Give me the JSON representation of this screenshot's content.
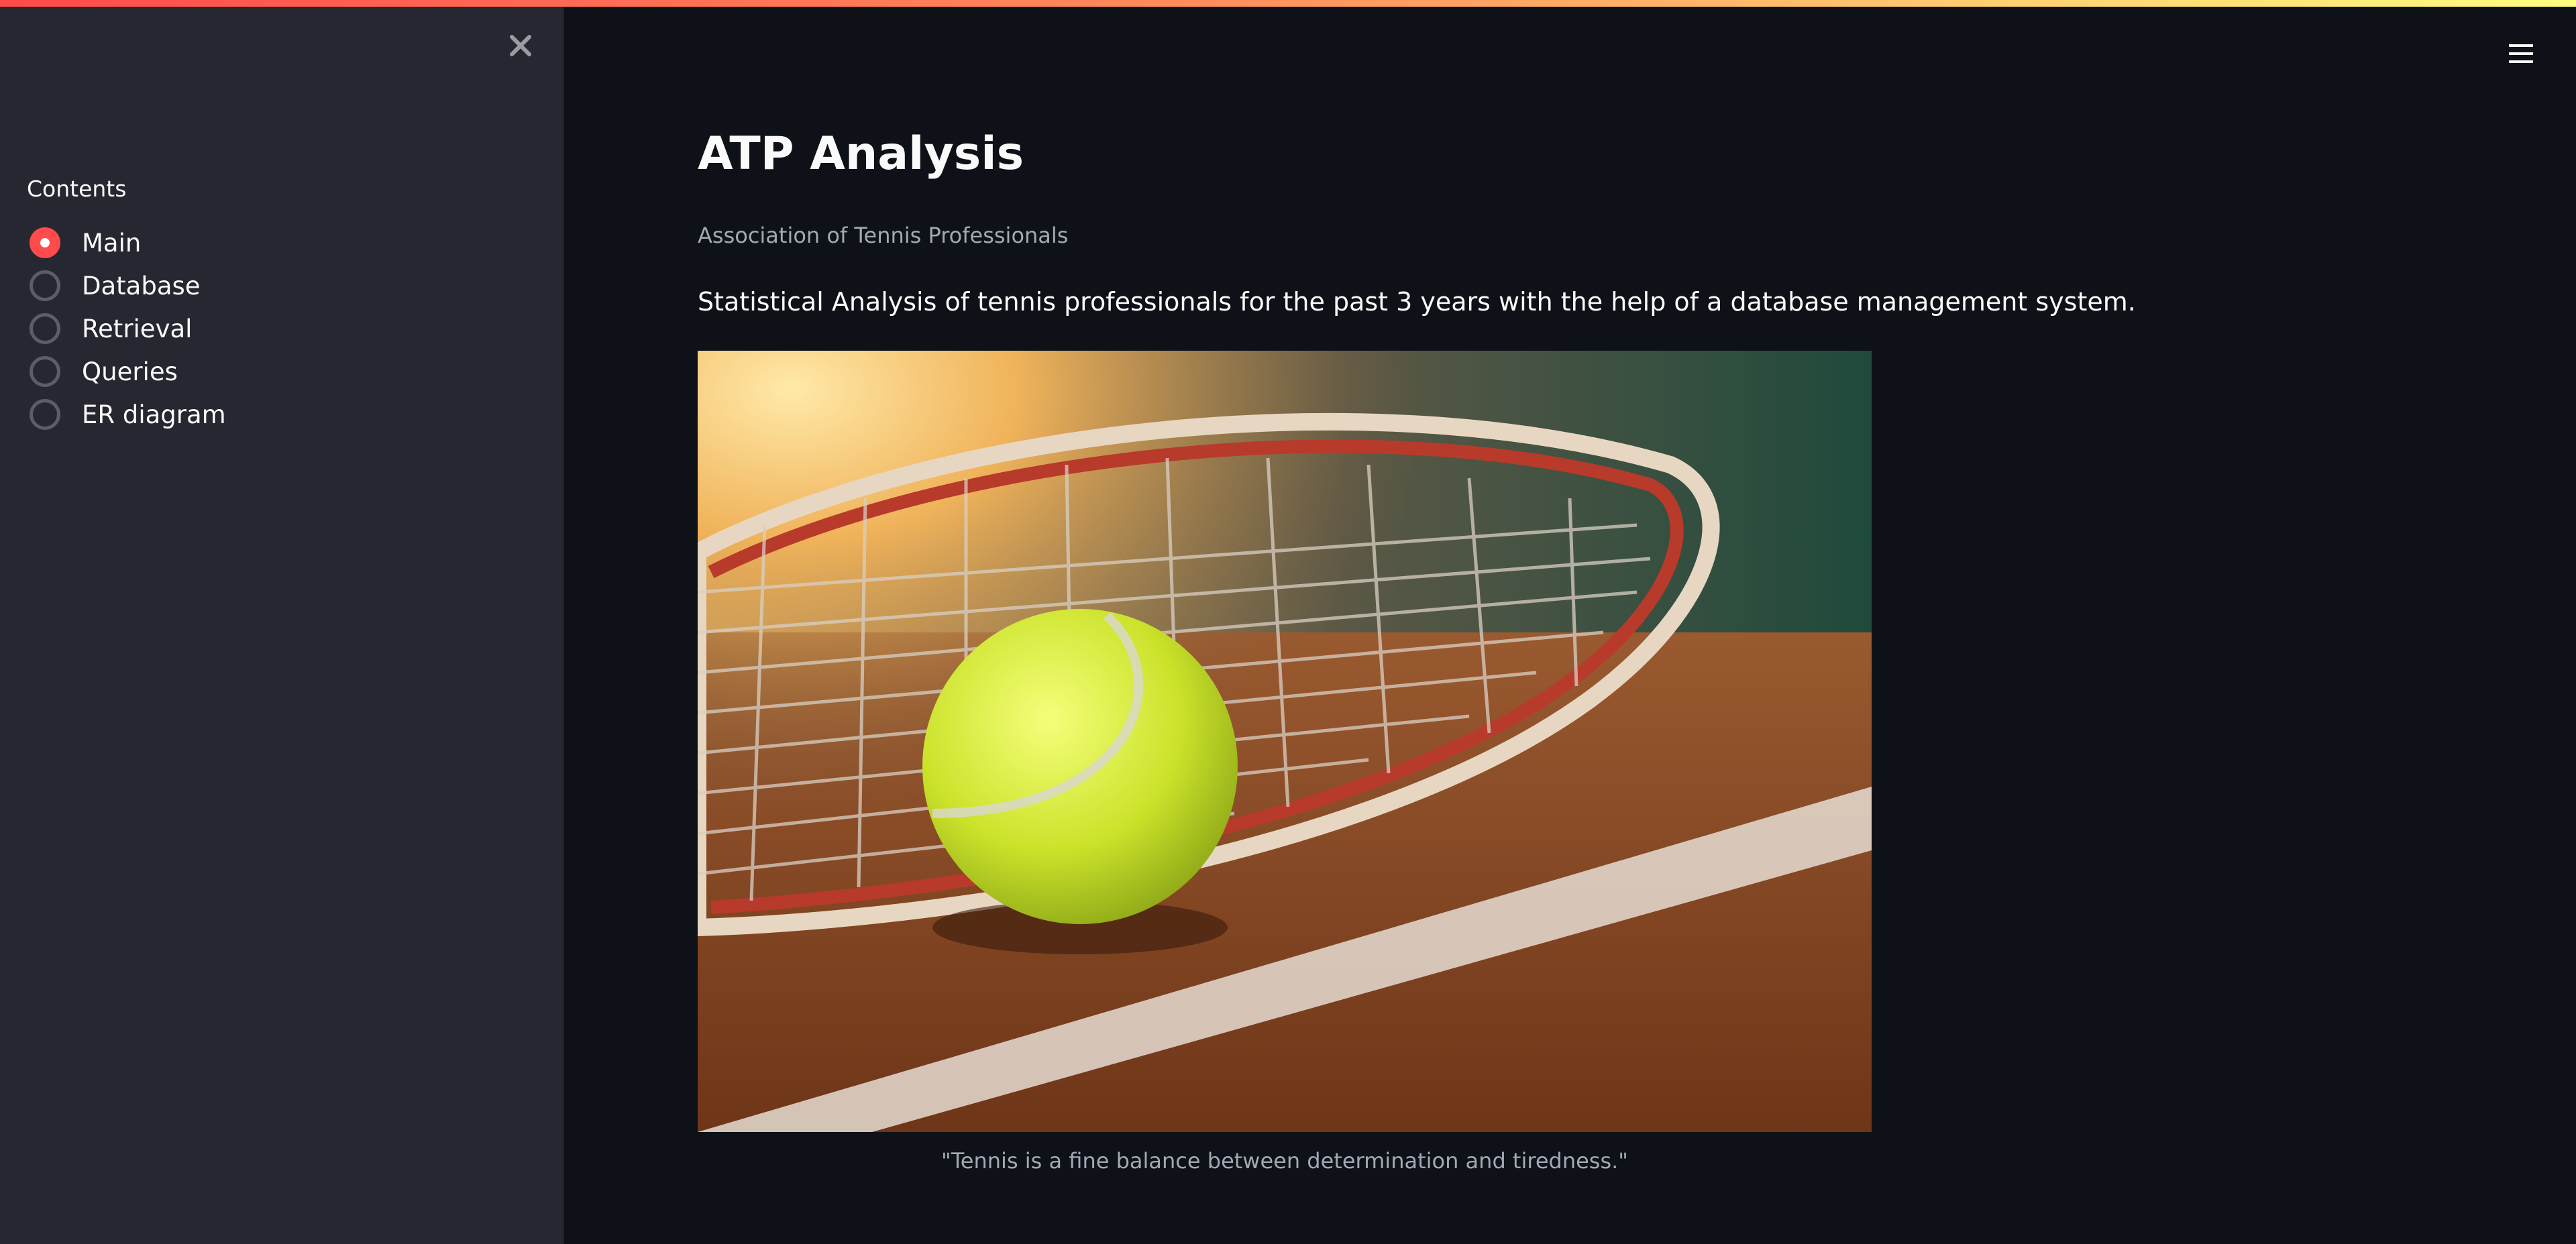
{
  "sidebar": {
    "contents_label": "Contents",
    "options": [
      {
        "label": "Main",
        "selected": true
      },
      {
        "label": "Database",
        "selected": false
      },
      {
        "label": "Retrieval",
        "selected": false
      },
      {
        "label": "Queries",
        "selected": false
      },
      {
        "label": "ER diagram",
        "selected": false
      }
    ]
  },
  "icons": {
    "close": "close-icon",
    "menu": "hamburger-menu-icon"
  },
  "main": {
    "title": "ATP Analysis",
    "subtitle": "Association of Tennis Professionals",
    "intro": "Statistical Analysis of tennis professionals for the past 3 years with the help of a database management system.",
    "image_caption": "\"Tennis is a fine balance between determination and tiredness.\""
  },
  "colors": {
    "accent": "#ff4b4b",
    "background": "#0e1117",
    "sidebar_background": "#262730"
  }
}
